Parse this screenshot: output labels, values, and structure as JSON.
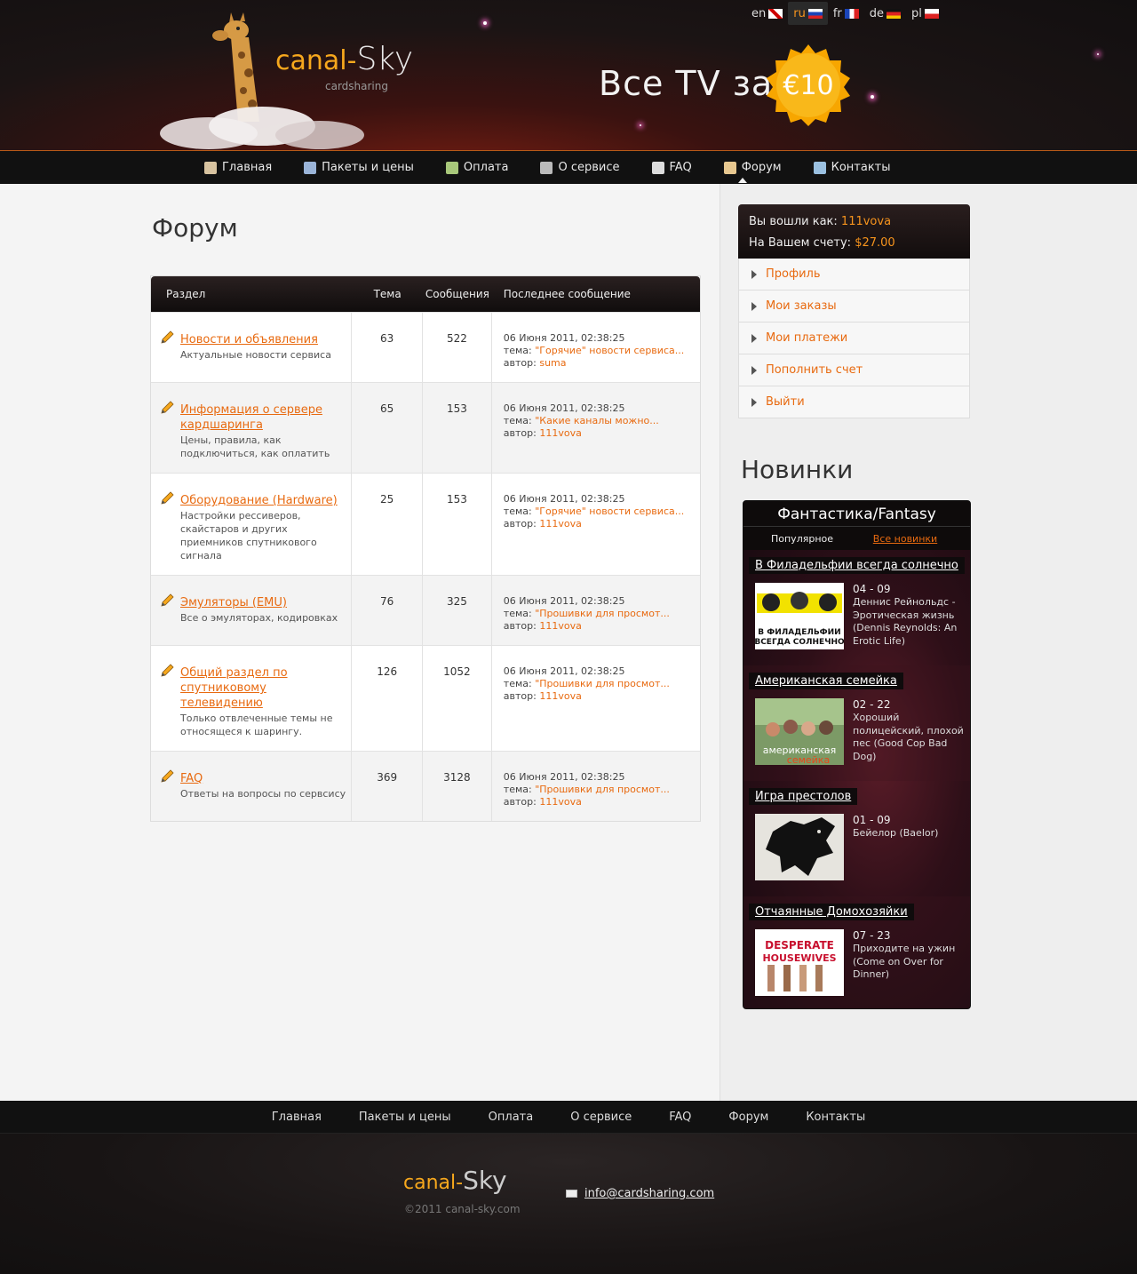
{
  "header": {
    "languages": [
      {
        "code": "en",
        "active": false
      },
      {
        "code": "ru",
        "active": true
      },
      {
        "code": "fr",
        "active": false
      },
      {
        "code": "de",
        "active": false
      },
      {
        "code": "pl",
        "active": false
      }
    ],
    "logo_part1": "canal-",
    "logo_part2": "Sky",
    "logo_sub": "cardsharing",
    "promo_text": "Все TV за",
    "badge_text": "€10"
  },
  "nav": {
    "items": [
      "Главная",
      "Пакеты и цены",
      "Оплата",
      "О сервисе",
      "FAQ",
      "Форум",
      "Контакты"
    ],
    "active": "Форум"
  },
  "page_title": "Форум",
  "forum": {
    "headers": {
      "section": "Раздел",
      "topics": "Тема",
      "messages": "Сообщения",
      "last": "Последнее сообщение"
    },
    "rows": [
      {
        "title": "Новости и объявления",
        "desc": "Актуальные новости сервиса",
        "topics": "63",
        "messages": "522",
        "date": "06 Июня 2011, 02:38:25",
        "topic": "\"Горячие\" новости сервиса...",
        "author": "suma"
      },
      {
        "title": "Информация о сервере кардшаринга",
        "desc": "Цены, правила, как подключиться, как оплатить",
        "topics": "65",
        "messages": "153",
        "date": "06 Июня 2011, 02:38:25",
        "topic": "\"Какие каналы можно...",
        "author": "111vova"
      },
      {
        "title": "Оборудование (Hardware)",
        "desc": "Настройки рессиверов, скайстаров и других приемников спутникового сигнала",
        "topics": "25",
        "messages": "153",
        "date": "06 Июня 2011, 02:38:25",
        "topic": "\"Горячие\" новости сервиса...",
        "author": "111vova"
      },
      {
        "title": "Эмуляторы (EMU)",
        "desc": "Все о эмуляторах, кодировках",
        "topics": "76",
        "messages": "325",
        "date": "06 Июня 2011, 02:38:25",
        "topic": "\"Прошивки для просмот...",
        "author": "111vova"
      },
      {
        "title": "Общий раздел по спутниковому телевидению",
        "desc": "Только отвлеченные темы не относящеся к шарингу.",
        "topics": "126",
        "messages": "1052",
        "date": "06 Июня 2011, 02:38:25",
        "topic": "\"Прошивки для просмот...",
        "author": "111vova"
      },
      {
        "title": "FAQ",
        "desc": "Ответы на вопросы по сервсису",
        "topics": "369",
        "messages": "3128",
        "date": "06 Июня 2011, 02:38:25",
        "topic": "\"Прошивки для просмот...",
        "author": "111vova"
      }
    ],
    "topic_label": "тема:",
    "author_label": "автор:"
  },
  "account": {
    "logged_label": "Вы вошли как:",
    "username": "111vova",
    "balance_label": "На Вашем счету:",
    "balance": "$27.00",
    "menu": [
      "Профиль",
      "Мои заказы",
      "Мои платежи",
      "Пополнить счет",
      "Выйти"
    ]
  },
  "novinki": {
    "title": "Новинки",
    "category": "Фантастика/Fantasy",
    "tab_popular": "Популярное",
    "tab_all": "Все новинки",
    "shows": [
      {
        "name": "В Филадельфии всегда солнечно",
        "episode": "04 - 09",
        "desc": "Деннис Рейнольдс - Эротическая жизнь (Dennis Reynolds: An Erotic Life)",
        "thumb_text": "В ФИЛАДЕЛЬФИИ ВСЕГДА СОЛНЕЧНО"
      },
      {
        "name": "Американская семейка",
        "episode": "02 - 22",
        "desc": "Хороший полицейский, плохой пес (Good Cop Bad Dog)",
        "thumb_text": "американская семейка"
      },
      {
        "name": "Игра престолов",
        "episode": "01 - 09",
        "desc": "Бейелор (Baelor)",
        "thumb_text": ""
      },
      {
        "name": "Отчаянные Домохозяйки",
        "episode": "07 - 23",
        "desc": "Приходите на ужин (Come on Over for Dinner)",
        "thumb_text": "DESPERATE HOUSEWIVES"
      }
    ]
  },
  "footer": {
    "nav": [
      "Главная",
      "Пакеты и цены",
      "Оплата",
      "О сервисе",
      "FAQ",
      "Форум",
      "Контакты"
    ],
    "logo_part1": "canal-",
    "logo_part2": "Sky",
    "copyright": "©2011  canal-sky.com",
    "email": "info@cardsharing.com"
  },
  "colors": {
    "accent": "#e86a10",
    "brand_yellow": "#f7a81d",
    "dark": "#111111"
  }
}
